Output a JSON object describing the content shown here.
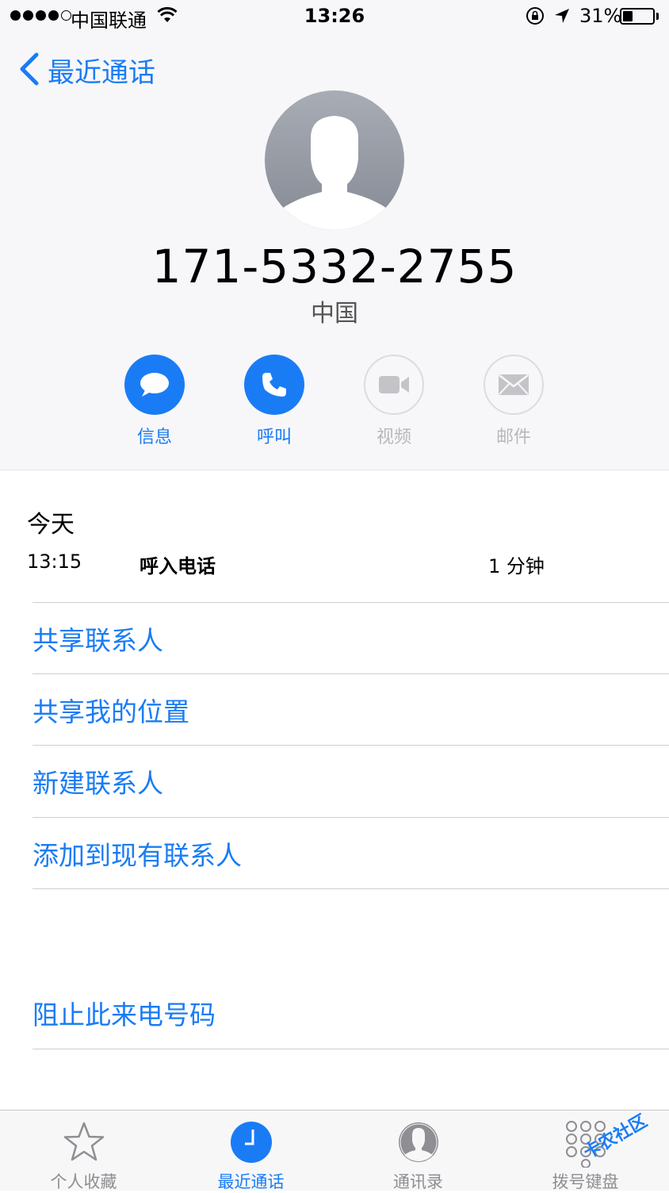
{
  "status_bar": {
    "carrier": "中国联通",
    "time": "13:26",
    "battery_percent": "31%",
    "battery_level": 0.31,
    "signal_dots_filled": 4
  },
  "nav": {
    "back_label": "最近通话",
    "back_icon": "chevron-left-icon"
  },
  "contact": {
    "number": "171-5332-2755",
    "region": "中国"
  },
  "actions": [
    {
      "label": "信息",
      "icon": "message-icon",
      "enabled": true
    },
    {
      "label": "呼叫",
      "icon": "phone-icon",
      "enabled": true
    },
    {
      "label": "视频",
      "icon": "video-icon",
      "enabled": false
    },
    {
      "label": "邮件",
      "icon": "mail-icon",
      "enabled": false
    }
  ],
  "call_history": {
    "day": "今天",
    "entries": [
      {
        "time": "13:15",
        "type": "呼入电话",
        "duration": "1 分钟"
      }
    ]
  },
  "menu": {
    "share_contact": "共享联系人",
    "share_location": "共享我的位置",
    "new_contact": "新建联系人",
    "add_to_existing": "添加到现有联系人",
    "block_caller": "阻止此来电号码"
  },
  "tabs": [
    {
      "label": "个人收藏",
      "icon": "star-icon",
      "active": false
    },
    {
      "label": "最近通话",
      "icon": "clock-icon",
      "active": true
    },
    {
      "label": "通讯录",
      "icon": "contacts-icon",
      "active": false
    },
    {
      "label": "拨号键盘",
      "icon": "keypad-icon",
      "active": false
    }
  ],
  "watermark": "卡农社区",
  "colors": {
    "accent": "#1a7cf5",
    "disabled": "#b8b8bc",
    "header_bg": "#f7f7f9"
  }
}
